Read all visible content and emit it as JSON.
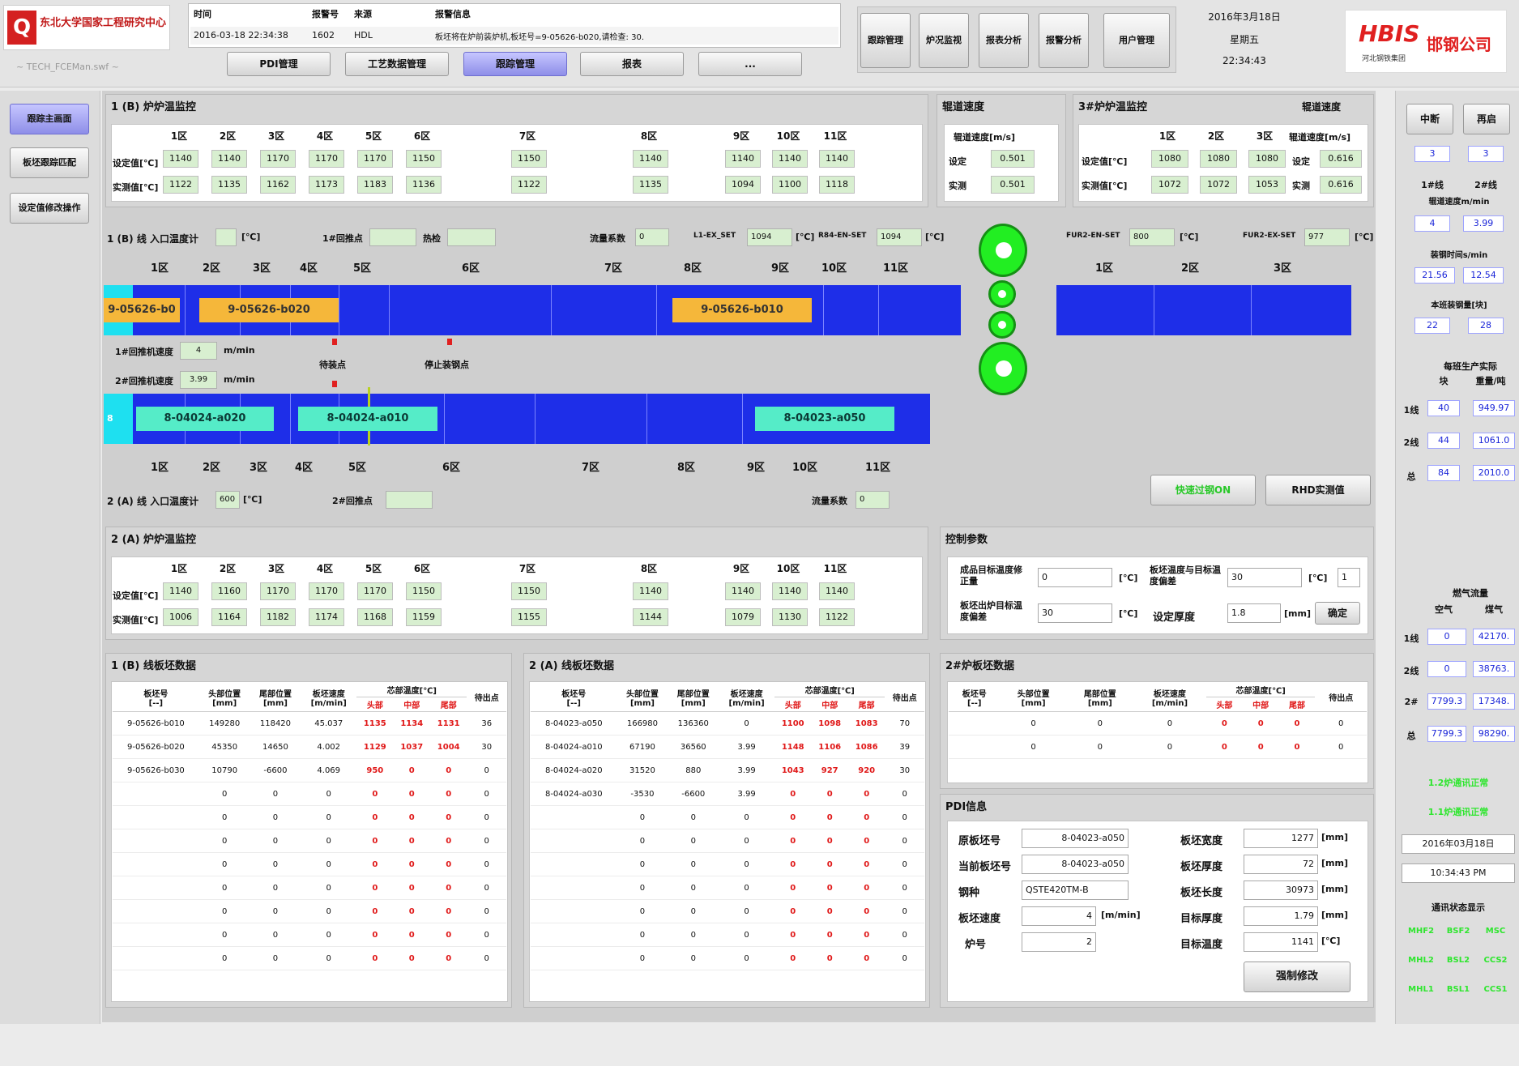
{
  "app": {
    "logo_text": "东北大学国家工程研究中心",
    "file": "~ TECH_FCEMan.swf ~",
    "brand": "HBIS",
    "brand_sub": "河北钢铁集团",
    "company": "邯钢公司"
  },
  "alarm": {
    "h_time": "时间",
    "h_code": "报警号",
    "h_src": "来源",
    "h_info": "报警信息",
    "time": "2016-03-18 22:34:38",
    "code": "1602",
    "src": "HDL",
    "info": "板坯将在炉前装炉机,板坯号=9-05626-b020,请检查: 30."
  },
  "nav": {
    "tabs": [
      "PDI管理",
      "工艺数据管理",
      "跟踪管理",
      "报表",
      "..."
    ],
    "right": [
      "跟踪管理",
      "炉况监视",
      "报表分析",
      "报警分析",
      "用户管理"
    ]
  },
  "datetime": {
    "date": "2016年3月18日",
    "weekday": "星期五",
    "time": "22:34:43"
  },
  "sidebar": {
    "items": [
      "跟踪主画面",
      "板坯跟踪匹配",
      "设定值修改操作"
    ]
  },
  "furnace_b": {
    "title": "1 (B) 炉炉温监控",
    "zones": [
      "1区",
      "2区",
      "3区",
      "4区",
      "5区",
      "6区",
      "7区",
      "8区",
      "9区",
      "10区",
      "11区"
    ],
    "set_label": "设定值[℃]",
    "act_label": "实测值[℃]",
    "set": [
      "1140",
      "1140",
      "1170",
      "1170",
      "1170",
      "1150",
      "1150",
      "1140",
      "1140",
      "1140",
      "1140"
    ],
    "act": [
      "1122",
      "1135",
      "1162",
      "1173",
      "1183",
      "1136",
      "1122",
      "1135",
      "1094",
      "1100",
      "1118"
    ]
  },
  "speed_panel": {
    "title": "辊道速度",
    "h": "辊道速度[m/s]",
    "set_label": "设定",
    "act_label": "实测",
    "set": "0.501",
    "act": "0.501"
  },
  "furnace3": {
    "title": "3#炉炉温监控",
    "speed_title": "辊道速度",
    "zones": [
      "1区",
      "2区",
      "3区"
    ],
    "h_speed": "辊道速度[m/s]",
    "set_label": "设定值[℃]",
    "act_label": "实测值[℃]",
    "set": [
      "1080",
      "1080",
      "1080"
    ],
    "act": [
      "1072",
      "1072",
      "1053"
    ],
    "sl": "设定",
    "al": "实测",
    "sp_set": "0.616",
    "sp_act": "0.616"
  },
  "track_b": {
    "entry_label": "1 (B) 线 入口温度计",
    "unit": "[℃]",
    "charge_label": "1#回推点",
    "end_label": "热检",
    "flow_label": "流量系数",
    "flow": "0",
    "l11_label": "L1-EX_SET",
    "l11": "1094",
    "r84_label": "R84-EN-SET",
    "r84": "1094",
    "zones": [
      "1区",
      "2区",
      "3区",
      "4区",
      "5区",
      "6区",
      "7区",
      "8区",
      "9区",
      "10区",
      "11区"
    ],
    "slabs": [
      "9-05626-b0",
      "9-05626-b020",
      "9-05626-b010"
    ],
    "speed1_label": "1#回推机速度",
    "speed1": "4",
    "speed2_label": "2#回推机速度",
    "speed2": "3.99",
    "speed_unit": "m/min",
    "m1": "待装点",
    "m2": "停止装钢点"
  },
  "track_a": {
    "entry_label": "2 (A) 线 入口温度计",
    "entry": "600",
    "unit": "[℃]",
    "charge_label": "2#回推点",
    "flow_label": "流量系数",
    "flow": "0",
    "end_mark": "8",
    "zones": [
      "1区",
      "2区",
      "3区",
      "4区",
      "5区",
      "6区",
      "7区",
      "8区",
      "9区",
      "10区",
      "11区"
    ],
    "slabs": [
      "8-04024-a020",
      "8-04024-a010",
      "8-04023-a050"
    ]
  },
  "track3": {
    "fur_en_label": "FUR2-EN-SET",
    "fur_en": "800",
    "fur_ex_label": "FUR2-EX-SET",
    "fur_ex": "977",
    "unit": "[℃]",
    "zones": [
      "1区",
      "2区",
      "3区"
    ]
  },
  "actions": {
    "b1": "快速过钢ON",
    "b2": "RHD实测值"
  },
  "furnace_a": {
    "title": "2 (A) 炉炉温监控",
    "zones": [
      "1区",
      "2区",
      "3区",
      "4区",
      "5区",
      "6区",
      "7区",
      "8区",
      "9区",
      "10区",
      "11区"
    ],
    "set_label": "设定值[℃]",
    "act_label": "实测值[℃]",
    "set": [
      "1140",
      "1160",
      "1170",
      "1170",
      "1170",
      "1150",
      "1150",
      "1140",
      "1140",
      "1140",
      "1140"
    ],
    "act": [
      "1006",
      "1164",
      "1182",
      "1174",
      "1168",
      "1159",
      "1155",
      "1144",
      "1079",
      "1130",
      "1122"
    ]
  },
  "control": {
    "title": "控制参数",
    "l1": "成品目标温度修正量",
    "v1": "0",
    "l2": "板坯温度与目标温度偏差",
    "v2": "30",
    "v2b": "1",
    "l3": "板坯出炉目标温度偏差",
    "v3": "30",
    "l4": "设定厚度",
    "v4": "1.8",
    "u_c": "[℃]",
    "u_mm": "[mm]",
    "ok": "确定"
  },
  "tbl_common": {
    "h": [
      "板坯号\n[--]",
      "头部位置\n[mm]",
      "尾部位置\n[mm]",
      "板坯速度\n[m/min]",
      "头部",
      "中部",
      "尾部",
      "待出点"
    ],
    "group": "芯部温度[℃]"
  },
  "slab_b": {
    "title": "1 (B) 线板坯数据",
    "rows": [
      [
        "9-05626-b010",
        "149280",
        "118420",
        "45.037",
        "1135",
        "1134",
        "1131",
        "36"
      ],
      [
        "9-05626-b020",
        "45350",
        "14650",
        "4.002",
        "1129",
        "1037",
        "1004",
        "30"
      ],
      [
        "9-05626-b030",
        "10790",
        "-6600",
        "4.069",
        "950",
        "0",
        "0",
        "0"
      ],
      [
        "",
        "0",
        "0",
        "0",
        "0",
        "0",
        "0",
        "0"
      ],
      [
        "",
        "0",
        "0",
        "0",
        "0",
        "0",
        "0",
        "0"
      ],
      [
        "",
        "0",
        "0",
        "0",
        "0",
        "0",
        "0",
        "0"
      ],
      [
        "",
        "0",
        "0",
        "0",
        "0",
        "0",
        "0",
        "0"
      ],
      [
        "",
        "0",
        "0",
        "0",
        "0",
        "0",
        "0",
        "0"
      ],
      [
        "",
        "0",
        "0",
        "0",
        "0",
        "0",
        "0",
        "0"
      ],
      [
        "",
        "0",
        "0",
        "0",
        "0",
        "0",
        "0",
        "0"
      ],
      [
        "",
        "0",
        "0",
        "0",
        "0",
        "0",
        "0",
        "0"
      ]
    ]
  },
  "slab_a": {
    "title": "2 (A) 线板坯数据",
    "rows": [
      [
        "8-04023-a050",
        "166980",
        "136360",
        "0",
        "1100",
        "1098",
        "1083",
        "70"
      ],
      [
        "8-04024-a010",
        "67190",
        "36560",
        "3.99",
        "1148",
        "1106",
        "1086",
        "39"
      ],
      [
        "8-04024-a020",
        "31520",
        "880",
        "3.99",
        "1043",
        "927",
        "920",
        "30"
      ],
      [
        "8-04024-a030",
        "-3530",
        "-6600",
        "3.99",
        "0",
        "0",
        "0",
        "0"
      ],
      [
        "",
        "0",
        "0",
        "0",
        "0",
        "0",
        "0",
        "0"
      ],
      [
        "",
        "0",
        "0",
        "0",
        "0",
        "0",
        "0",
        "0"
      ],
      [
        "",
        "0",
        "0",
        "0",
        "0",
        "0",
        "0",
        "0"
      ],
      [
        "",
        "0",
        "0",
        "0",
        "0",
        "0",
        "0",
        "0"
      ],
      [
        "",
        "0",
        "0",
        "0",
        "0",
        "0",
        "0",
        "0"
      ],
      [
        "",
        "0",
        "0",
        "0",
        "0",
        "0",
        "0",
        "0"
      ],
      [
        "",
        "0",
        "0",
        "0",
        "0",
        "0",
        "0",
        "0"
      ]
    ]
  },
  "slab_3": {
    "title": "2#炉板坯数据",
    "rows": [
      [
        "",
        "0",
        "0",
        "0",
        "0",
        "0",
        "0",
        "0"
      ],
      [
        "",
        "0",
        "0",
        "0",
        "0",
        "0",
        "0",
        "0"
      ]
    ]
  },
  "pdi": {
    "title": "PDI信息",
    "l_orig": "原板坯号",
    "orig": "8-04023-a050",
    "l_cur": "当前板坯号",
    "cur": "8-04023-a050",
    "l_grade": "钢种",
    "grade": "QSTE420TM-B",
    "l_speed": "板坯速度",
    "speed": "4",
    "speed_u": "[m/min]",
    "l_fur": "炉号",
    "fur": "2",
    "l_w": "板坯宽度",
    "w": "1277",
    "l_t": "板坯厚度",
    "t": "72",
    "l_len": "板坯长度",
    "len": "30973",
    "u_mm": "[mm]",
    "l_tt": "目标厚度",
    "tt": "1.79",
    "l_temp": "目标温度",
    "temp": "1141",
    "u_c": "[℃]",
    "force": "强制修改"
  },
  "right": {
    "btn1": "中断",
    "btn2": "再启",
    "v1": "3",
    "v2": "3",
    "h1": "1#线",
    "h2": "2#线",
    "h3": "辊道速度m/min",
    "s1": "4",
    "s2": "3.99",
    "h4": "装钢时间s/min",
    "t1": "21.56",
    "t2": "12.54",
    "h5": "本班装钢量[块]",
    "c1": "22",
    "c2": "28",
    "h6": "每班生产实际",
    "h6a": "块",
    "h6b": "重量/吨",
    "r1l": "1线",
    "r1a": "40",
    "r1b": "949.97",
    "r2l": "2线",
    "r2a": "44",
    "r2b": "1061.0",
    "r3l": "总",
    "r3a": "84",
    "r3b": "2010.0",
    "h7": "燃气流量",
    "h7a": "空气",
    "h7b": "煤气",
    "g1l": "1线",
    "g1a": "0",
    "g1b": "42170.",
    "g2l": "2线",
    "g2a": "0",
    "g2b": "38763.",
    "g3l": "2#",
    "g3a": "7799.3",
    "g3b": "17348.",
    "g4l": "总",
    "g4a": "7799.3",
    "g4b": "98290.",
    "gt1": "1.2炉通讯正常",
    "gt2": "1.1炉通讯正常",
    "date": "2016年03月18日",
    "time": "10:34:43 PM",
    "st_title": "通讯状态显示",
    "st": [
      "MHF2",
      "BSF2",
      "MSC",
      "MHL2",
      "BSL2",
      "CCS2",
      "MHL1",
      "BSL1",
      "CCS1"
    ]
  }
}
